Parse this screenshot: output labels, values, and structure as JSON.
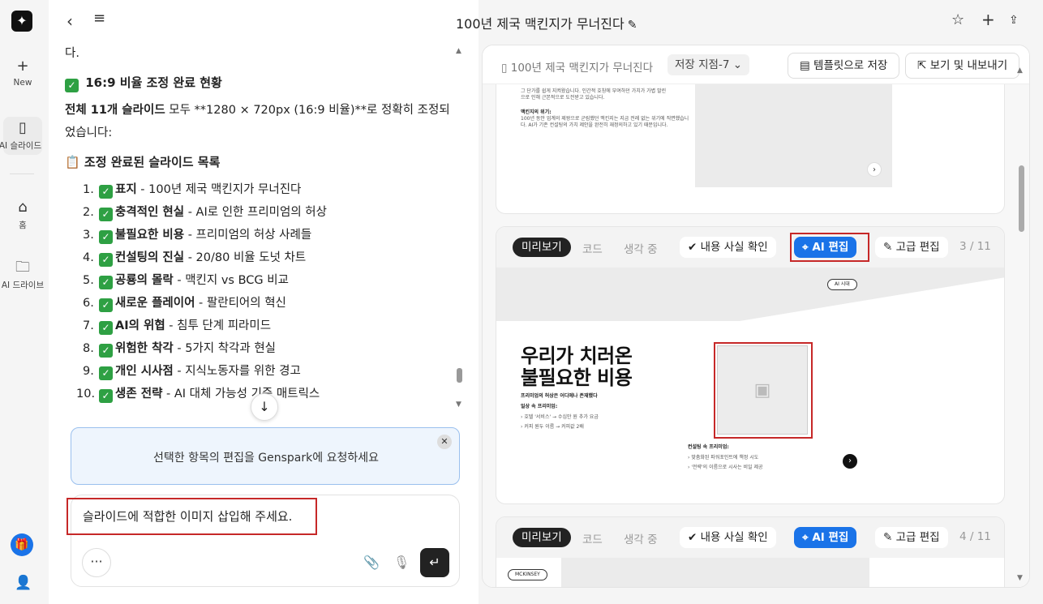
{
  "rail": {
    "new_label": "New",
    "slides_label": "AI 슬라이드",
    "home_label": "홈",
    "drive_label": "AI 드라이브"
  },
  "header": {
    "doc_title": "100년 제국 맥킨지가 무너진다",
    "back_icon": "chevron-left-icon",
    "menu_icon": "menu-icon",
    "star_icon": "star-icon",
    "plus_icon": "plus-icon",
    "share_icon": "share-icon"
  },
  "chat": {
    "leading_text": "다.",
    "section1_title": "16:9 비율 조정 완료 현황",
    "summary_bold": "전체 11개 슬라이드",
    "summary_rest": " 모두 **1280 × 720px (16:9 비율)**로 정확히 조정되었습니다:",
    "section2_title": "📋 조정 완료된 슬라이드 목록",
    "items": [
      {
        "num": "1.",
        "bold": "표지",
        "rest": " - 100년 제국 맥킨지가 무너진다"
      },
      {
        "num": "2.",
        "bold": "충격적인 현실",
        "rest": " - AI로 인한 프리미엄의 허상"
      },
      {
        "num": "3.",
        "bold": "불필요한 비용",
        "rest": " - 프리미엄의 허상 사례들"
      },
      {
        "num": "4.",
        "bold": "컨설팅의 진실",
        "rest": " - 20/80 비율 도넛 차트"
      },
      {
        "num": "5.",
        "bold": "공룡의 몰락",
        "rest": " - 맥킨지 vs BCG 비교"
      },
      {
        "num": "6.",
        "bold": "새로운 플레이어",
        "rest": " - 팔란티어의 혁신"
      },
      {
        "num": "7.",
        "bold": "AI의 위협",
        "rest": " - 침투 단계 피라미드"
      },
      {
        "num": "8.",
        "bold": "위험한 착각",
        "rest": " - 5가지 착각과 현실"
      },
      {
        "num": "9.",
        "bold": "개인 시사점",
        "rest": " - 지식노동자를 위한 경고"
      },
      {
        "num": "10.",
        "bold": "생존 전략",
        "rest": " - AI 대체 가능성 기준 매트릭스"
      }
    ],
    "context_text": "선택한 항목의 편집을 Genspark에 요청하세요",
    "input_value": "슬라이드에 적합한 이미지 삽입해 주세요.",
    "more_label": "···"
  },
  "panel": {
    "title": "100년 제국 맥킨지가 무너진다",
    "save_point": "저장 지점-7",
    "template_btn": "템플릿으로 저장",
    "export_btn": "보기 및 내보내기",
    "toolbar": {
      "preview": "미리보기",
      "code": "코드",
      "thinking": "생각 중",
      "fact_check": "내용 사실 확인",
      "ai_edit": "AI 편집",
      "advanced_edit": "고급 편집"
    },
    "slide2_text": {
      "line1": "그 단가를 쉽게 지켜왔습니다. 인간적 호칭에 부여하던 가치가 가볍 말린",
      "line2": "으로 인해 근본적으로 도전받고 있습니다.",
      "heading": "맥킨지의 위기:",
      "body1": "100년 동안 업계의 제왕으로 군림했던 맥킨지는 지금 전례 없는 위기에 직면했습니",
      "body2": "다. AI가 기존 컨설팅의 가치 제안을 완전히 재정의하고 있기 때문입니다."
    },
    "slide3": {
      "page": "3 / 11",
      "badge": "AI 시대",
      "title_l1": "우리가 치러온",
      "title_l2": "불필요한 비용",
      "subtitle": "프리미엄의 허상은 어디에나 존재했다",
      "daily_heading": "일상 속 프리미엄:",
      "daily1": "호텔 '서비스' → 수십만 원 추가 요금",
      "daily2": "커피 원두 이름 → 커피값 2배",
      "consult_heading": "컨설팅 속 프리미엄:",
      "consult1": "맞춤화된 파워포인트에 책정 시도",
      "consult2": "'전략'의 이름으로 시사는 비일 제공"
    },
    "slide4": {
      "page": "4 / 11",
      "badge": "MCKINSEY"
    }
  }
}
